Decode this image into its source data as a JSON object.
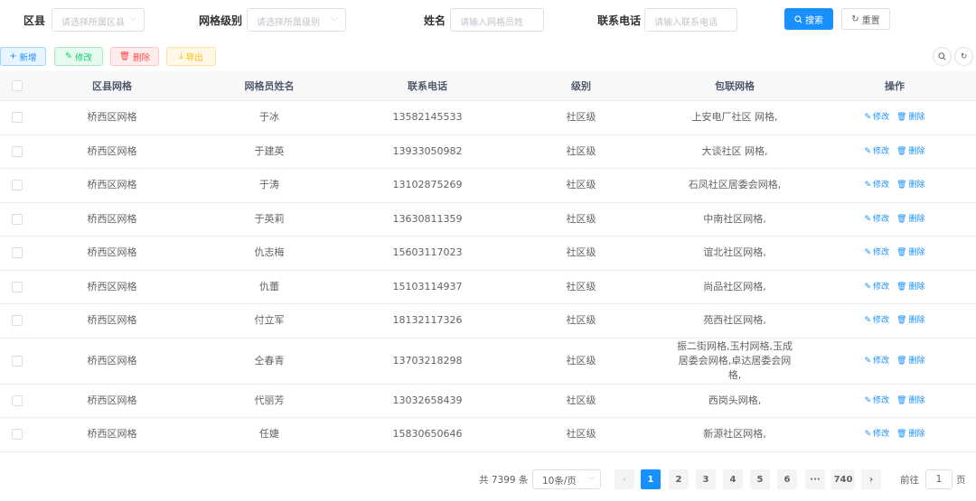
{
  "filters": {
    "district_label": "区县",
    "district_placeholder": "请选择所属区县",
    "grid_level_label": "网格级别",
    "grid_level_placeholder": "请选择所属级别",
    "name_label": "姓名",
    "name_placeholder": "请输入网格员姓",
    "phone_label": "联系电话",
    "phone_placeholder": "请输入联系电话",
    "search_label": "搜索",
    "reset_label": "重置"
  },
  "toolbar": {
    "add_label": "新增",
    "edit_label": "修改",
    "delete_label": "删除",
    "export_label": "导出"
  },
  "table": {
    "headers": [
      "区县网格",
      "网格员姓名",
      "联系电话",
      "级别",
      "包联网格",
      "操作"
    ],
    "rows": [
      {
        "district": "桥西区网格",
        "name": "于冰",
        "phone": "13582145533",
        "level": "社区级",
        "grids": "上安电厂社区 网格,"
      },
      {
        "district": "桥西区网格",
        "name": "于建英",
        "phone": "13933050982",
        "level": "社区级",
        "grids": "大谈社区 网格,"
      },
      {
        "district": "桥西区网格",
        "name": "于涛",
        "phone": "13102875269",
        "level": "社区级",
        "grids": "石凤社区居委会网格,"
      },
      {
        "district": "桥西区网格",
        "name": "于英莉",
        "phone": "13630811359",
        "level": "社区级",
        "grids": "中南社区网格,"
      },
      {
        "district": "桥西区网格",
        "name": "仇志梅",
        "phone": "15603117023",
        "level": "社区级",
        "grids": "谊北社区网格,"
      },
      {
        "district": "桥西区网格",
        "name": "仇蕾",
        "phone": "15103114937",
        "level": "社区级",
        "grids": "尚品社区网格,"
      },
      {
        "district": "桥西区网格",
        "name": "付立军",
        "phone": "18132117326",
        "level": "社区级",
        "grids": "苑西社区网格,"
      },
      {
        "district": "桥西区网格",
        "name": "仝春青",
        "phone": "13703218298",
        "level": "社区级",
        "grids": "振二街网格,玉村网格,玉成居委会网格,卓达居委会网格,"
      },
      {
        "district": "桥西区网格",
        "name": "代丽芳",
        "phone": "13032658439",
        "level": "社区级",
        "grids": "西岗头网格,"
      },
      {
        "district": "桥西区网格",
        "name": "任婕",
        "phone": "15830650646",
        "level": "社区级",
        "grids": "新源社区网格,"
      }
    ],
    "row_edit_label": "修改",
    "row_delete_label": "删除"
  },
  "pagination": {
    "total_text": "共 7399 条",
    "page_size": "10条/页",
    "pages": [
      "1",
      "2",
      "3",
      "4",
      "5",
      "6"
    ],
    "ellipsis": "···",
    "last_page": "740",
    "current_page": "1",
    "goto_label": "前往",
    "goto_value": "1",
    "goto_unit": "页"
  },
  "colors": {
    "primary": "#1890ff",
    "success": "#13ce66",
    "danger": "#ff4949",
    "warning": "#ffba00"
  }
}
